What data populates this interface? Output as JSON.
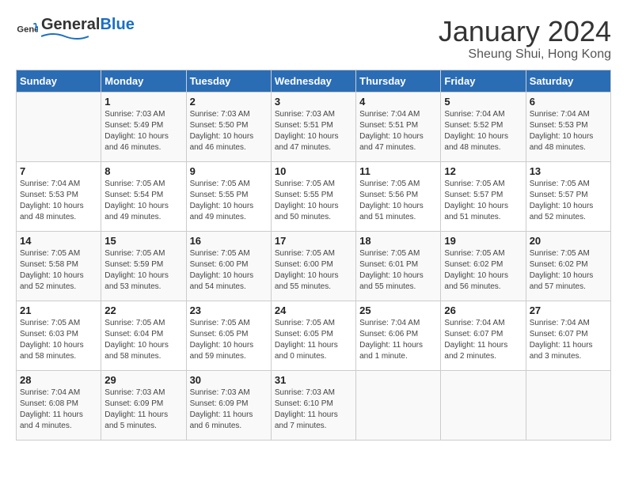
{
  "logo": {
    "text_general": "General",
    "text_blue": "Blue"
  },
  "title": "January 2024",
  "location": "Sheung Shui, Hong Kong",
  "days_of_week": [
    "Sunday",
    "Monday",
    "Tuesday",
    "Wednesday",
    "Thursday",
    "Friday",
    "Saturday"
  ],
  "weeks": [
    [
      {
        "day": "",
        "info": ""
      },
      {
        "day": "1",
        "info": "Sunrise: 7:03 AM\nSunset: 5:49 PM\nDaylight: 10 hours\nand 46 minutes."
      },
      {
        "day": "2",
        "info": "Sunrise: 7:03 AM\nSunset: 5:50 PM\nDaylight: 10 hours\nand 46 minutes."
      },
      {
        "day": "3",
        "info": "Sunrise: 7:03 AM\nSunset: 5:51 PM\nDaylight: 10 hours\nand 47 minutes."
      },
      {
        "day": "4",
        "info": "Sunrise: 7:04 AM\nSunset: 5:51 PM\nDaylight: 10 hours\nand 47 minutes."
      },
      {
        "day": "5",
        "info": "Sunrise: 7:04 AM\nSunset: 5:52 PM\nDaylight: 10 hours\nand 48 minutes."
      },
      {
        "day": "6",
        "info": "Sunrise: 7:04 AM\nSunset: 5:53 PM\nDaylight: 10 hours\nand 48 minutes."
      }
    ],
    [
      {
        "day": "7",
        "info": "Sunrise: 7:04 AM\nSunset: 5:53 PM\nDaylight: 10 hours\nand 48 minutes."
      },
      {
        "day": "8",
        "info": "Sunrise: 7:05 AM\nSunset: 5:54 PM\nDaylight: 10 hours\nand 49 minutes."
      },
      {
        "day": "9",
        "info": "Sunrise: 7:05 AM\nSunset: 5:55 PM\nDaylight: 10 hours\nand 49 minutes."
      },
      {
        "day": "10",
        "info": "Sunrise: 7:05 AM\nSunset: 5:55 PM\nDaylight: 10 hours\nand 50 minutes."
      },
      {
        "day": "11",
        "info": "Sunrise: 7:05 AM\nSunset: 5:56 PM\nDaylight: 10 hours\nand 51 minutes."
      },
      {
        "day": "12",
        "info": "Sunrise: 7:05 AM\nSunset: 5:57 PM\nDaylight: 10 hours\nand 51 minutes."
      },
      {
        "day": "13",
        "info": "Sunrise: 7:05 AM\nSunset: 5:57 PM\nDaylight: 10 hours\nand 52 minutes."
      }
    ],
    [
      {
        "day": "14",
        "info": "Sunrise: 7:05 AM\nSunset: 5:58 PM\nDaylight: 10 hours\nand 52 minutes."
      },
      {
        "day": "15",
        "info": "Sunrise: 7:05 AM\nSunset: 5:59 PM\nDaylight: 10 hours\nand 53 minutes."
      },
      {
        "day": "16",
        "info": "Sunrise: 7:05 AM\nSunset: 6:00 PM\nDaylight: 10 hours\nand 54 minutes."
      },
      {
        "day": "17",
        "info": "Sunrise: 7:05 AM\nSunset: 6:00 PM\nDaylight: 10 hours\nand 55 minutes."
      },
      {
        "day": "18",
        "info": "Sunrise: 7:05 AM\nSunset: 6:01 PM\nDaylight: 10 hours\nand 55 minutes."
      },
      {
        "day": "19",
        "info": "Sunrise: 7:05 AM\nSunset: 6:02 PM\nDaylight: 10 hours\nand 56 minutes."
      },
      {
        "day": "20",
        "info": "Sunrise: 7:05 AM\nSunset: 6:02 PM\nDaylight: 10 hours\nand 57 minutes."
      }
    ],
    [
      {
        "day": "21",
        "info": "Sunrise: 7:05 AM\nSunset: 6:03 PM\nDaylight: 10 hours\nand 58 minutes."
      },
      {
        "day": "22",
        "info": "Sunrise: 7:05 AM\nSunset: 6:04 PM\nDaylight: 10 hours\nand 58 minutes."
      },
      {
        "day": "23",
        "info": "Sunrise: 7:05 AM\nSunset: 6:05 PM\nDaylight: 10 hours\nand 59 minutes."
      },
      {
        "day": "24",
        "info": "Sunrise: 7:05 AM\nSunset: 6:05 PM\nDaylight: 11 hours\nand 0 minutes."
      },
      {
        "day": "25",
        "info": "Sunrise: 7:04 AM\nSunset: 6:06 PM\nDaylight: 11 hours\nand 1 minute."
      },
      {
        "day": "26",
        "info": "Sunrise: 7:04 AM\nSunset: 6:07 PM\nDaylight: 11 hours\nand 2 minutes."
      },
      {
        "day": "27",
        "info": "Sunrise: 7:04 AM\nSunset: 6:07 PM\nDaylight: 11 hours\nand 3 minutes."
      }
    ],
    [
      {
        "day": "28",
        "info": "Sunrise: 7:04 AM\nSunset: 6:08 PM\nDaylight: 11 hours\nand 4 minutes."
      },
      {
        "day": "29",
        "info": "Sunrise: 7:03 AM\nSunset: 6:09 PM\nDaylight: 11 hours\nand 5 minutes."
      },
      {
        "day": "30",
        "info": "Sunrise: 7:03 AM\nSunset: 6:09 PM\nDaylight: 11 hours\nand 6 minutes."
      },
      {
        "day": "31",
        "info": "Sunrise: 7:03 AM\nSunset: 6:10 PM\nDaylight: 11 hours\nand 7 minutes."
      },
      {
        "day": "",
        "info": ""
      },
      {
        "day": "",
        "info": ""
      },
      {
        "day": "",
        "info": ""
      }
    ]
  ]
}
